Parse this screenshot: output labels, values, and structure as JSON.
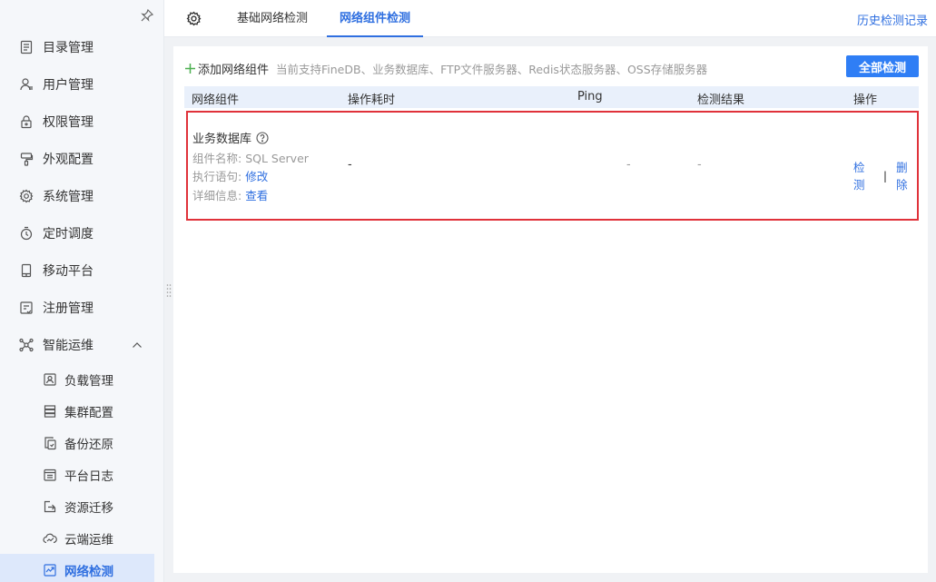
{
  "sidebar": {
    "items": [
      {
        "label": "目录管理",
        "icon": "catalog-icon"
      },
      {
        "label": "用户管理",
        "icon": "user-icon"
      },
      {
        "label": "权限管理",
        "icon": "lock-icon"
      },
      {
        "label": "外观配置",
        "icon": "brush-icon"
      },
      {
        "label": "系统管理",
        "icon": "gear-icon"
      },
      {
        "label": "定时调度",
        "icon": "timer-icon"
      },
      {
        "label": "移动平台",
        "icon": "mobile-icon"
      },
      {
        "label": "注册管理",
        "icon": "register-icon"
      },
      {
        "label": "智能运维",
        "icon": "ops-icon"
      }
    ],
    "sub_items": [
      {
        "label": "负载管理",
        "icon": "load-icon"
      },
      {
        "label": "集群配置",
        "icon": "cluster-icon"
      },
      {
        "label": "备份还原",
        "icon": "backup-icon"
      },
      {
        "label": "平台日志",
        "icon": "log-icon"
      },
      {
        "label": "资源迁移",
        "icon": "migrate-icon"
      },
      {
        "label": "云端运维",
        "icon": "cloud-icon"
      },
      {
        "label": "网络检测",
        "icon": "network-check-icon",
        "active": true
      }
    ]
  },
  "header": {
    "tabs": [
      {
        "label": "基础网络检测",
        "active": false
      },
      {
        "label": "网络组件检测",
        "active": true
      }
    ],
    "history_link": "历史检测记录"
  },
  "toolbar": {
    "add_label": "添加网络组件",
    "support_text": "当前支持FineDB、业务数据库、FTP文件服务器、Redis状态服务器、OSS存储服务器",
    "check_all_label": "全部检测"
  },
  "table": {
    "columns": [
      "网络组件",
      "操作耗时",
      "Ping",
      "检测结果",
      "操作"
    ],
    "rows": [
      {
        "title": "业务数据库",
        "name_label": "组件名称:",
        "name_value": "SQL Server",
        "stmt_label": "执行语句:",
        "stmt_action": "修改",
        "detail_label": "详细信息:",
        "detail_action": "查看",
        "duration": "-",
        "ping": "-",
        "result": "-",
        "actions": {
          "check": "检测",
          "separator": "|",
          "delete": "删除"
        }
      }
    ]
  },
  "colors": {
    "accent": "#2f6fe0",
    "button": "#2f7ef5",
    "highlight_border": "#e0323a",
    "add_plus": "#4caf50"
  }
}
